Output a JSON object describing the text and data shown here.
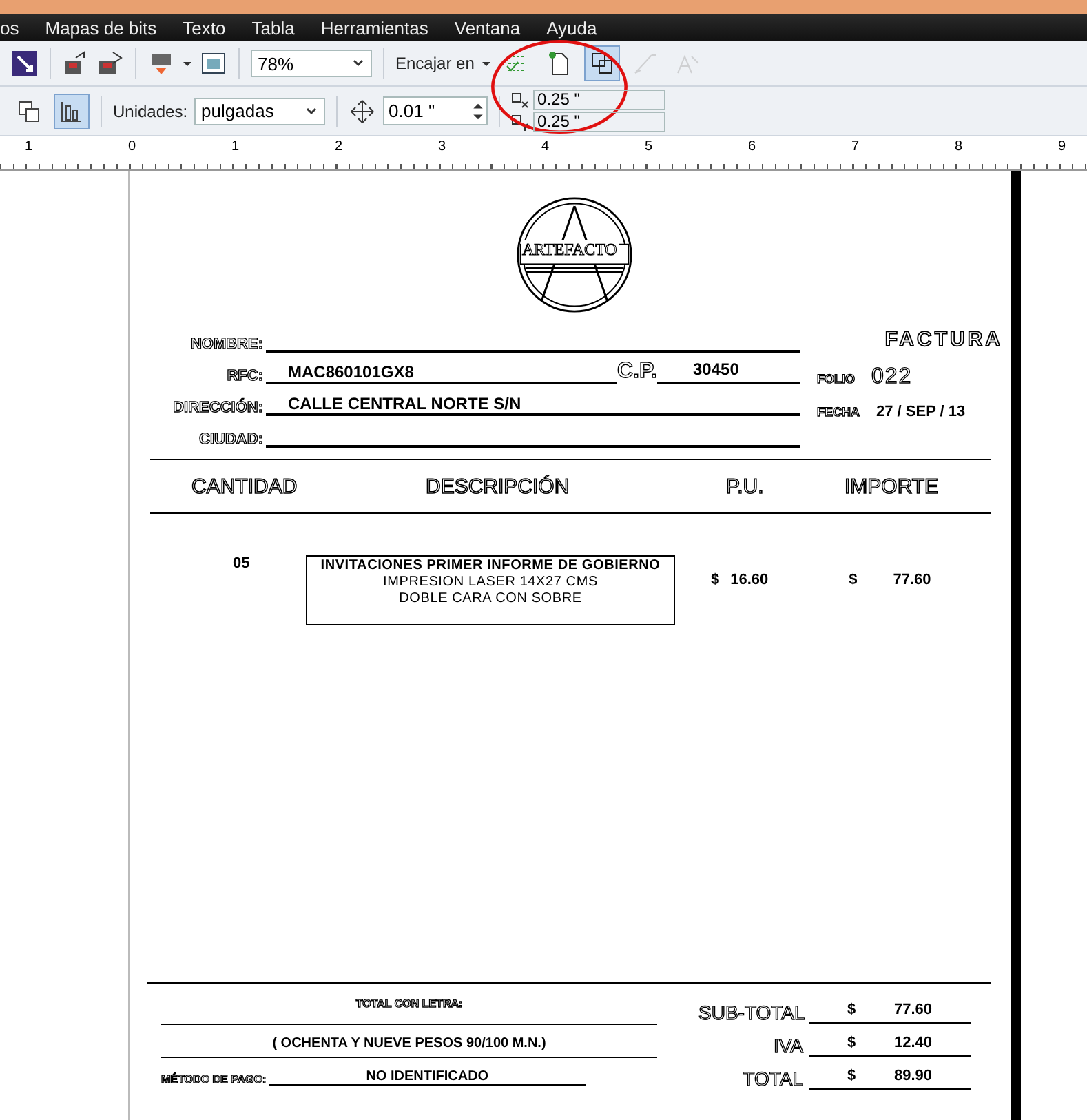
{
  "menu": [
    "os",
    "Mapas de bits",
    "Texto",
    "Tabla",
    "Herramientas",
    "Ventana",
    "Ayuda"
  ],
  "toolbar": {
    "zoom": "78%",
    "snap_label": "Encajar en",
    "snap_buttons": [
      {
        "kind": "guides",
        "selected": false,
        "disabled": false
      },
      {
        "kind": "page",
        "selected": false,
        "disabled": false
      },
      {
        "kind": "objects",
        "selected": true,
        "disabled": false
      },
      {
        "kind": "dynamic",
        "selected": false,
        "disabled": true
      },
      {
        "kind": "text",
        "selected": false,
        "disabled": true
      }
    ]
  },
  "property_bar": {
    "units_label": "Unidades:",
    "units": "pulgadas",
    "nudge": "0.01 \"",
    "duplicate_x": "0.25 \"",
    "duplicate_y": "0.25 \"",
    "layout_buttons": [
      {
        "selected": false
      },
      {
        "selected": true
      }
    ]
  },
  "ruler": [
    "1",
    "0",
    "1",
    "2",
    "3",
    "4",
    "5",
    "6",
    "7",
    "8",
    "9"
  ],
  "invoice": {
    "logo_text": "ARTEFACTO",
    "title": "FACTURA",
    "fields": [
      {
        "label": "NOMBRE:"
      },
      {
        "label": "RFC:",
        "value": "MAC860101GX8",
        "extra_label": "C.P.",
        "extra_value": "30450"
      },
      {
        "label": "DIRECCIÓN:",
        "value": "CALLE CENTRAL NORTE S/N"
      },
      {
        "label": "CIUDAD:"
      }
    ],
    "folio_label": "FOLIO",
    "folio": "022",
    "fecha_label": "FECHA",
    "fecha": "27 / SEP / 13",
    "columns": [
      "CANTIDAD",
      "DESCRIPCIÓN",
      "P.U.",
      "IMPORTE"
    ],
    "rows": [
      {
        "cantidad": "05",
        "description": [
          "INVITACIONES PRIMER INFORME DE GOBIERNO",
          "IMPRESION LASER 14X27 CMS",
          "DOBLE CARA CON SOBRE"
        ],
        "pu_currency": "$",
        "pu": "16.60",
        "importe_currency": "$",
        "importe": "77.60"
      }
    ],
    "total_letra_label": "TOTAL CON LETRA:",
    "total_letra": "( OCHENTA Y NUEVE PESOS  90/100 M.N.)",
    "metodo_label": "MÉTODO DE PAGO:",
    "metodo": "NO IDENTIFICADO",
    "totals": [
      {
        "label": "SUB-TOTAL",
        "currency": "$",
        "value": "77.60"
      },
      {
        "label": "IVA",
        "currency": "$",
        "value": "12.40"
      },
      {
        "label": "TOTAL",
        "currency": "$",
        "value": "89.90"
      }
    ]
  }
}
